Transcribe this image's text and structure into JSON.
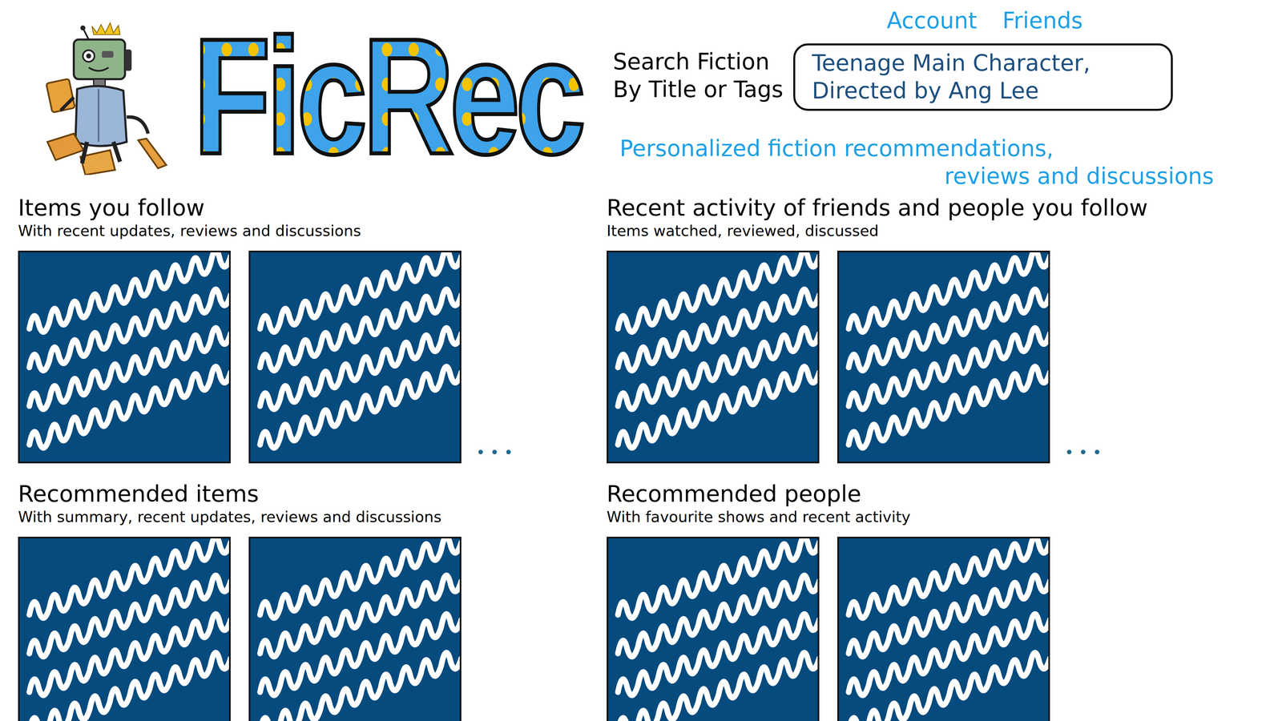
{
  "logo": {
    "text": "FicRec"
  },
  "nav": [
    {
      "label": "Account"
    },
    {
      "label": "Friends"
    }
  ],
  "search": {
    "label_lines": [
      "Search Fiction",
      "By Title or Tags"
    ],
    "value": "Teenage Main Character,\nDirected by Ang Lee"
  },
  "tagline": [
    "Personalized fiction recommendations,",
    "reviews and discussions"
  ],
  "sections": [
    {
      "title": "Items you follow",
      "subtitle": "With recent updates, reviews and discussions",
      "cards": [
        {},
        {}
      ],
      "more": "• • •"
    },
    {
      "title": "Recent activity of friends and people you follow",
      "subtitle": "Items watched, reviewed, discussed",
      "cards": [
        {},
        {}
      ],
      "more": "• • •"
    },
    {
      "title": "Recommended items",
      "subtitle": "With summary, recent updates, reviews and discussions",
      "cards": [
        {},
        {}
      ],
      "more": ""
    },
    {
      "title": "Recommended people",
      "subtitle": "With favourite shows and recent activity",
      "cards": [
        {},
        {}
      ],
      "more": ""
    }
  ]
}
